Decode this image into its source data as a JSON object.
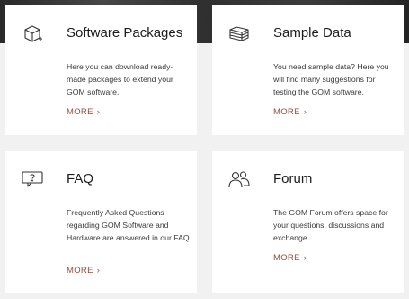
{
  "cards": [
    {
      "icon": "package-box-icon",
      "title": "Software Packages",
      "description": "Here you can download ready-made packages to extend your GOM software.",
      "more_label": "MORE",
      "more_icon": "chevron-right-icon"
    },
    {
      "icon": "stacked-layers-icon",
      "title": "Sample Data",
      "description": "You need sample data? Here you will find many suggestions for testing the GOM software.",
      "more_label": "MORE",
      "more_icon": "chevron-right-icon"
    },
    {
      "icon": "chat-question-icon",
      "title": "FAQ",
      "description": "Frequently Asked Questions regarding GOM Software and Hardware are answered in our FAQ.",
      "more_label": "MORE",
      "more_icon": "chevron-right-icon"
    },
    {
      "icon": "users-icon",
      "title": "Forum",
      "description": "The GOM Forum offers space for your questions, discussions and exchange.",
      "more_label": "MORE",
      "more_icon": "chevron-right-icon"
    }
  ],
  "colors": {
    "background": "#f1f1f1",
    "card": "#ffffff",
    "accent": "#9c4a3c",
    "header_band": "#333333"
  }
}
